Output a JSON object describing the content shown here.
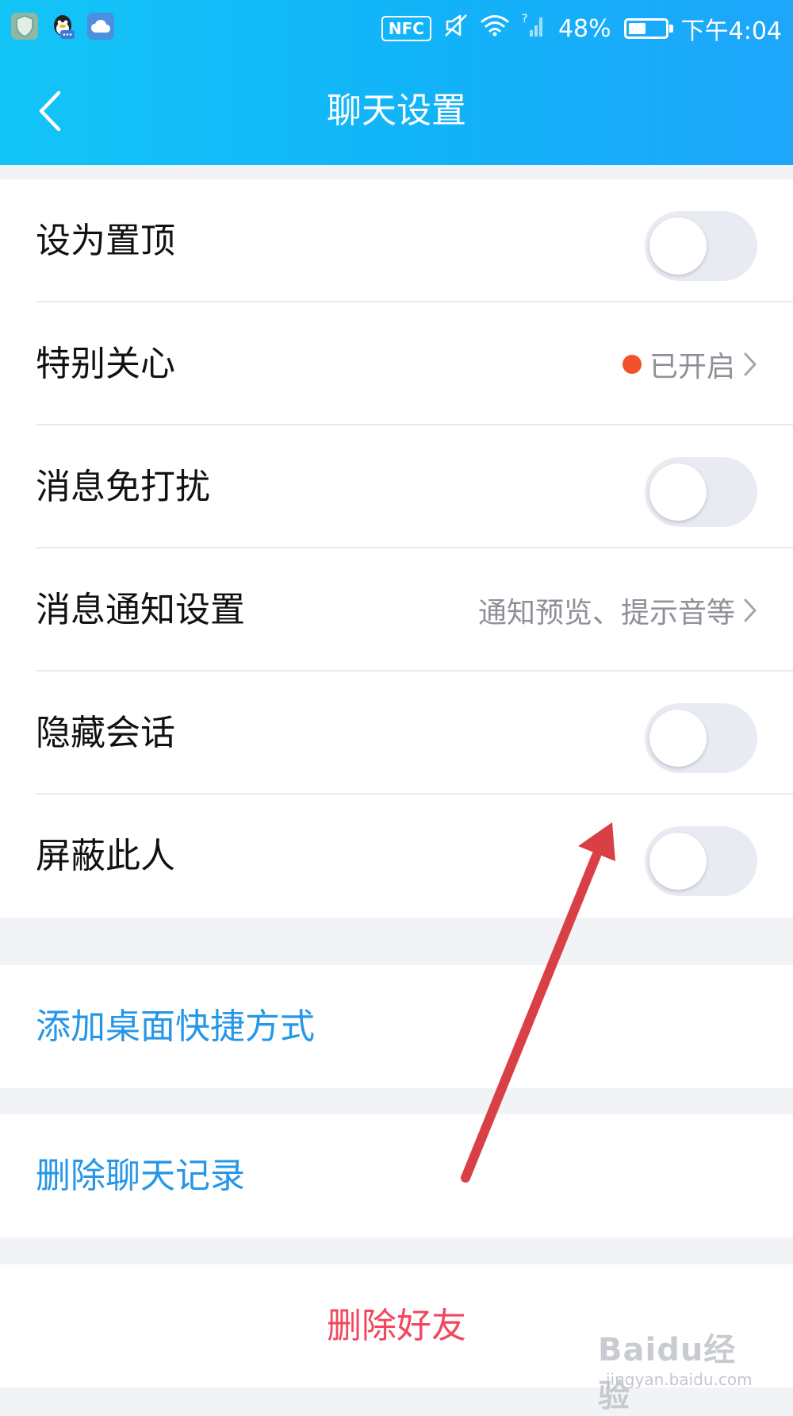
{
  "status_bar": {
    "nfc_label": "NFC",
    "battery_percent": "48%",
    "battery_level": 0.48,
    "time": "下午4:04",
    "icons": [
      "shield-icon",
      "qq-icon",
      "cloud-icon",
      "nfc-icon",
      "mute-icon",
      "wifi-icon",
      "signal-icon",
      "battery-icon"
    ]
  },
  "header": {
    "title": "聊天设置",
    "back_icon": "chevron-left-icon"
  },
  "settings": [
    {
      "label": "设为置顶",
      "control": "toggle",
      "on": false
    },
    {
      "label": "特别关心",
      "control": "link",
      "value": "已开启",
      "dot_color": "#f2512a"
    },
    {
      "label": "消息免打扰",
      "control": "toggle",
      "on": false
    },
    {
      "label": "消息通知设置",
      "control": "link",
      "value": "通知预览、提示音等"
    },
    {
      "label": "隐藏会话",
      "control": "toggle",
      "on": false
    },
    {
      "label": "屏蔽此人",
      "control": "toggle",
      "on": false
    }
  ],
  "actions": {
    "add_shortcut": "添加桌面快捷方式",
    "clear_history": "删除聊天记录",
    "delete_friend": "删除好友"
  },
  "watermark": {
    "brand": "Baidu经验",
    "url": "jingyan.baidu.com"
  },
  "colors": {
    "header_gradient_start": "#13c5f7",
    "header_gradient_end": "#1ea6fb",
    "link_blue": "#2596e8",
    "danger_red": "#f2475d",
    "arrow_red": "#d94045"
  }
}
